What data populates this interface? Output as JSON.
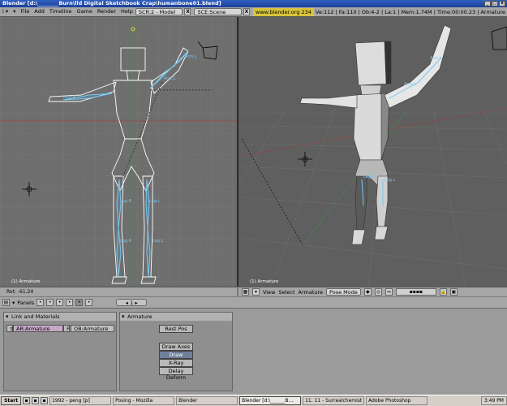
{
  "window": {
    "title": "Blender [d:\\________Burn\\lld Digital Sketchbook Crap\\humanbone01.blend]"
  },
  "infobar": {
    "menu": [
      "File",
      "Add",
      "Timeline",
      "Game",
      "Render",
      "Help"
    ],
    "screen": "SCR:2 - Model",
    "scene": "SCE:Scene",
    "url": "www.blender.org 234",
    "stats": "Ve:112 | Fa:110 | Ob:4-2 | La:1 | Mem:1.74M | Time:00:00.23 | Armature"
  },
  "viewports": {
    "left_label": "(1) Armature",
    "right_label": "(1) Armature",
    "left_footer": "Rot: -61.24",
    "bones_left": [
      "Arm.L",
      "Arm.L",
      "Arm.R",
      "Leg.R",
      "Leg.L",
      "Leg.R",
      "Leg.L"
    ],
    "bones_right": [
      "Arm.L",
      "Arm.L",
      "Leg.R",
      "Leg.L"
    ]
  },
  "viewheader": {
    "menus": [
      "View",
      "Select",
      "Armature"
    ],
    "mode": "Pose Mode"
  },
  "buttons": {
    "panels_label": "Panels",
    "frame": "1",
    "link_panel_title": "Link and Materials",
    "ar_field": "AR:Armature",
    "f_label": "F",
    "ob_field": "OB:Armature",
    "armature_panel_title": "Armature",
    "rest_pos": "Rest Pos",
    "draw_axes": "Draw Axes",
    "draw_names": "Draw Names",
    "xray": "X-Ray",
    "delay_deform": "Delay Deform"
  },
  "taskbar": {
    "start": "Start",
    "tasks": [
      "1992 - peng  [p]",
      "Posing - Mozilla",
      "Blender",
      "Blender [d:\\______B...",
      "11. 11 - Surrealchemist - ...",
      "Adobe Photoshop"
    ],
    "clock": "3:49 PM"
  },
  "colors": {
    "bone": "#76c8f0",
    "header": "#a6a6a6",
    "url_bg": "#d8c43a"
  }
}
